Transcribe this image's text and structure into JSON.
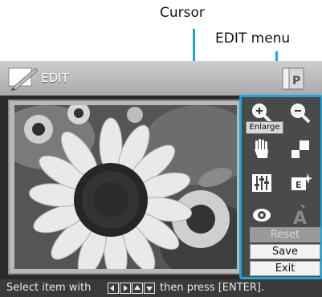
{
  "callouts": {
    "cursor": "Cursor",
    "edit_menu": "EDIT menu"
  },
  "header": {
    "title": "EDIT"
  },
  "edit_menu": {
    "tooltip": "Enlarge",
    "buttons": {
      "reset": "Reset",
      "save": "Save",
      "exit": "Exit"
    },
    "items": [
      "enlarge-icon",
      "reduce-icon",
      "hand-move-icon",
      "resize-icon",
      "adjust-sliders-icon",
      "effect-icon",
      "red-eye-icon",
      "text-icon"
    ]
  },
  "status": {
    "prefix": "Select item with",
    "suffix": "then press [ENTER]."
  },
  "colors": {
    "callout_line": "#1aa6e0",
    "screen_bg": "#2a2a2a",
    "menu_bg": "#4a4a4a"
  }
}
